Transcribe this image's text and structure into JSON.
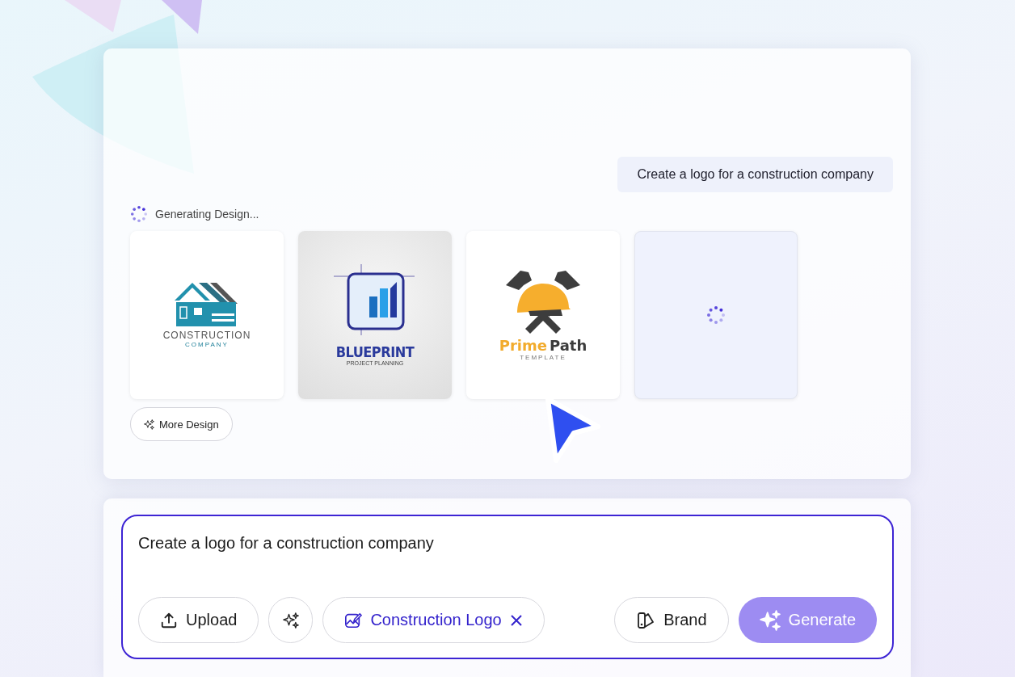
{
  "chat": {
    "user_message": "Create a logo for a construction company"
  },
  "status": {
    "text": "Generating Design..."
  },
  "designs": [
    {
      "kind": "house",
      "title": "CONSTRUCTION",
      "subtitle": "COMPANY"
    },
    {
      "kind": "blueprint",
      "title": "BLUEPRINT",
      "subtitle": "PROJECT PLANNING"
    },
    {
      "kind": "helmet",
      "title": "Prime",
      "title_accent": "Path",
      "subtitle": "TEMPLATE"
    },
    {
      "kind": "loading"
    }
  ],
  "more_button": {
    "label": "More Design"
  },
  "prompt": {
    "value": "Create a logo for a construction company",
    "buttons": [
      {
        "kind": "upload",
        "label": "Upload"
      },
      {
        "kind": "magic"
      },
      {
        "kind": "tag",
        "label": "Construction Logo",
        "removable": true
      }
    ],
    "brand_button": {
      "label": "Brand"
    },
    "generate_button": {
      "label": "Generate",
      "disabled": true
    }
  }
}
